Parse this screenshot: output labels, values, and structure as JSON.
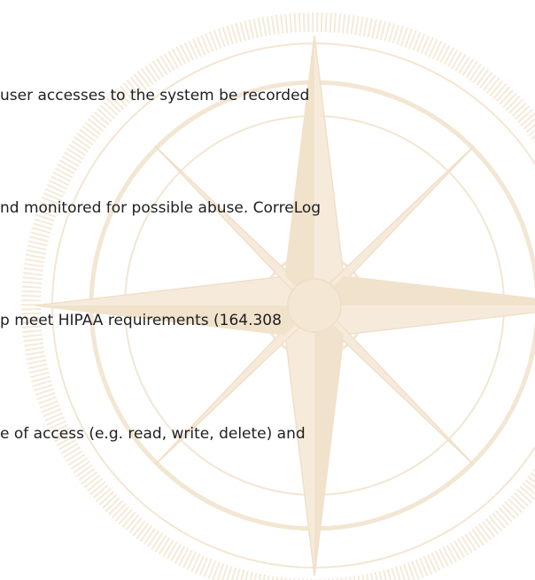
{
  "document": {
    "lines": [
      "user accesses to the system be recorded",
      "nd monitored for possible abuse. CorreLog",
      "p meet HIPAA requirements (164.308",
      "e of access (e.g. read, write, delete) and"
    ]
  },
  "colors": {
    "watermark": "#f3e6d2",
    "text": "#1e1e1e",
    "background": "#ffffff"
  },
  "watermark": {
    "icon": "compass-rose-icon"
  }
}
